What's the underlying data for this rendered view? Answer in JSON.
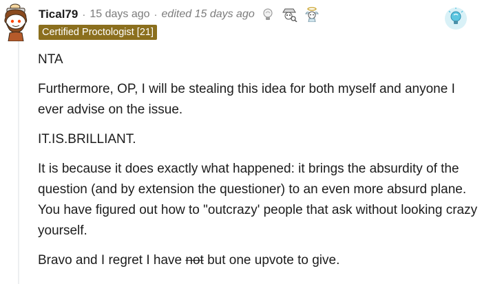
{
  "comment": {
    "username": "Tical79",
    "timestamp": "15 days ago",
    "edited": "edited 15 days ago",
    "separator": "·",
    "flair": "Certified Proctologist [21]",
    "awards": [
      "lightbulb-award-icon",
      "detective-award-icon",
      "angel-award-icon"
    ],
    "badge_icon": "lightbulb-badge-icon",
    "paragraphs": {
      "p1": "NTA",
      "p2": "Furthermore, OP, I will be stealing this idea for both myself and anyone I ever advise on the issue.",
      "p3": "IT.IS.BRILLIANT.",
      "p4": "It is because it does exactly what happened: it brings the absurdity of the question (and by extension the questioner) to an even more absurd plane. You have figured out how to \"outcrazy' people that ask without looking crazy yourself.",
      "p5_before": "Bravo and I regret I have ",
      "p5_strike": "not",
      "p5_after": " but one upvote to give."
    }
  },
  "colors": {
    "flair_bg": "#8b6f1e",
    "meta_text": "#7c7c7c",
    "body_text": "#1c1c1c",
    "thread_line": "#edeff1"
  }
}
